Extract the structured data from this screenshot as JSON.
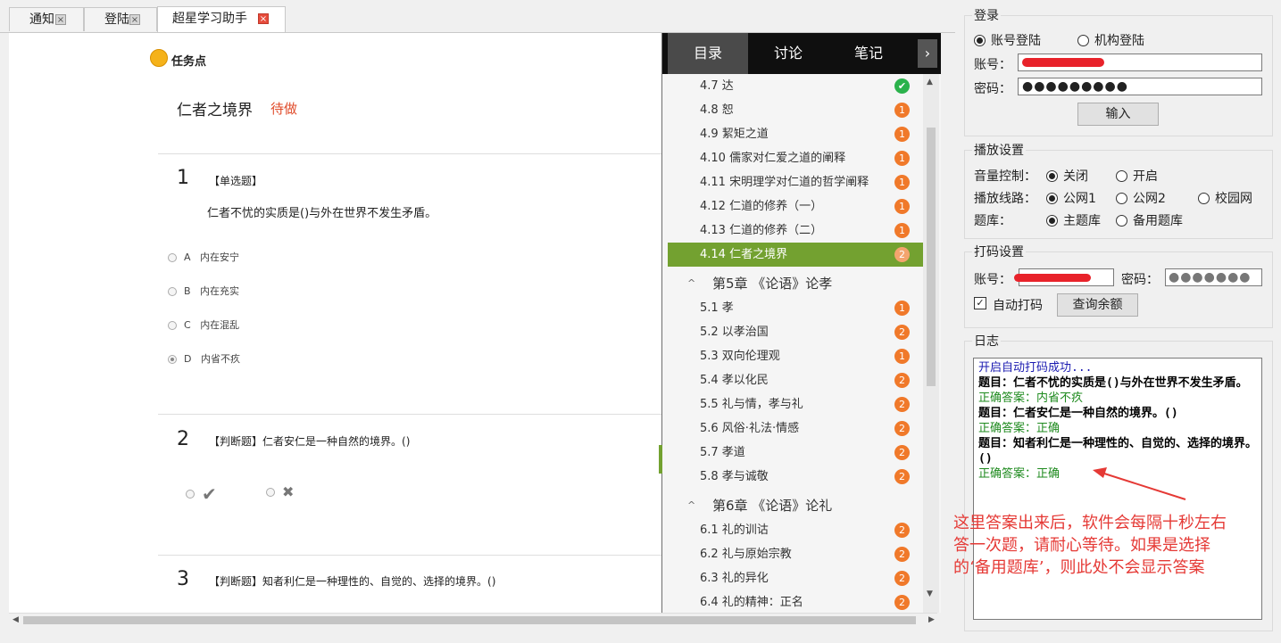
{
  "tabs": [
    {
      "label": "通知",
      "close": "×"
    },
    {
      "label": "登陆",
      "close": "×"
    },
    {
      "label": "超星学习助手",
      "close": "×"
    }
  ],
  "task": {
    "header": "任务点",
    "title": "仁者之境界",
    "status": "待做"
  },
  "questions": [
    {
      "num": "1",
      "type": "【单选题】",
      "text": "仁者不忧的实质是()与外在世界不发生矛盾。",
      "options": [
        {
          "letter": "A",
          "text": "内在安宁"
        },
        {
          "letter": "B",
          "text": "内在充实"
        },
        {
          "letter": "C",
          "text": "内在混乱"
        },
        {
          "letter": "D",
          "text": "内省不疚"
        }
      ]
    },
    {
      "num": "2",
      "type": "【判断题】",
      "text": "仁者安仁是一种自然的境界。()",
      "true_mark": "✔",
      "false_mark": "✖"
    },
    {
      "num": "3",
      "type": "【判断题】",
      "text": "知者利仁是一种理性的、自觉的、选择的境界。()"
    }
  ],
  "sidebar": {
    "tabs": [
      "目录",
      "讨论",
      "笔记"
    ],
    "more": "›",
    "items": [
      {
        "label": "4.7 达",
        "badge": "✔",
        "done": true
      },
      {
        "label": "4.8 恕",
        "badge": "1"
      },
      {
        "label": "4.9 絜矩之道",
        "badge": "1"
      },
      {
        "label": "4.10 儒家对仁爱之道的阐释",
        "badge": "1"
      },
      {
        "label": "4.11 宋明理学对仁道的哲学阐释",
        "badge": "1"
      },
      {
        "label": "4.12 仁道的修养（一）",
        "badge": "1"
      },
      {
        "label": "4.13 仁道的修养（二）",
        "badge": "1"
      },
      {
        "label": "4.14 仁者之境界",
        "badge": "2",
        "active": true
      }
    ],
    "chapter5": {
      "label": "第5章 《论语》论孝",
      "chev": "^"
    },
    "items5": [
      {
        "label": "5.1 孝",
        "badge": "1"
      },
      {
        "label": "5.2 以孝治国",
        "badge": "2"
      },
      {
        "label": "5.3 双向伦理观",
        "badge": "1"
      },
      {
        "label": "5.4 孝以化民",
        "badge": "2"
      },
      {
        "label": "5.5 礼与情，孝与礼",
        "badge": "2"
      },
      {
        "label": "5.6 风俗·礼法·情感",
        "badge": "2"
      },
      {
        "label": "5.7 孝道",
        "badge": "2"
      },
      {
        "label": "5.8 孝与诚敬",
        "badge": "2"
      }
    ],
    "chapter6": {
      "label": "第6章 《论语》论礼",
      "chev": "^"
    },
    "items6": [
      {
        "label": "6.1 礼的训诂",
        "badge": "2"
      },
      {
        "label": "6.2 礼与原始宗教",
        "badge": "2"
      },
      {
        "label": "6.3 礼的异化",
        "badge": "2"
      },
      {
        "label": "6.4 礼的精神：正名",
        "badge": "2"
      }
    ]
  },
  "login": {
    "legend": "登录",
    "mode_account": "账号登陆",
    "mode_org": "机构登陆",
    "account_label": "账号：",
    "password_label": "密码：",
    "password_value": "●●●●●●●●●",
    "submit": "输入"
  },
  "playback": {
    "legend": "播放设置",
    "volume_label": "音量控制：",
    "volume_off": "关闭",
    "volume_on": "开启",
    "route_label": "播放线路：",
    "route1": "公网1",
    "route2": "公网2",
    "route3": "校园网",
    "bank_label": "题库：",
    "bank_main": "主题库",
    "bank_backup": "备用题库"
  },
  "captcha": {
    "legend": "打码设置",
    "account_label": "账号：",
    "password_label": "密码：",
    "password_value": "●●●●●●●",
    "auto_label": "自动打码",
    "query_button": "查询余额"
  },
  "log": {
    "legend": "日志",
    "lines": [
      {
        "text": "开启自动打码成功...",
        "style": "blue"
      },
      {
        "text": "题目：仁者不忧的实质是()与外在世界不发生矛盾。",
        "style": "bold"
      },
      {
        "text": "正确答案：内省不疚",
        "style": "green"
      },
      {
        "text": "题目：仁者安仁是一种自然的境界。()",
        "style": "bold"
      },
      {
        "text": "正确答案：正确",
        "style": "green"
      },
      {
        "text": "题目：知者利仁是一种理性的、自觉的、选择的境界。()",
        "style": "bold"
      },
      {
        "text": "正确答案：正确",
        "style": "green"
      }
    ]
  },
  "annotation": "这里答案出来后，软件会每隔十秒左右答一次题，请耐心等待。如果是选择的‘备用题库’，则此处不会显示答案",
  "colors": {
    "accent_green": "#73a130",
    "badge_orange": "#f0792a",
    "status_red": "#e04b2a",
    "annotation_red": "#e53935"
  }
}
